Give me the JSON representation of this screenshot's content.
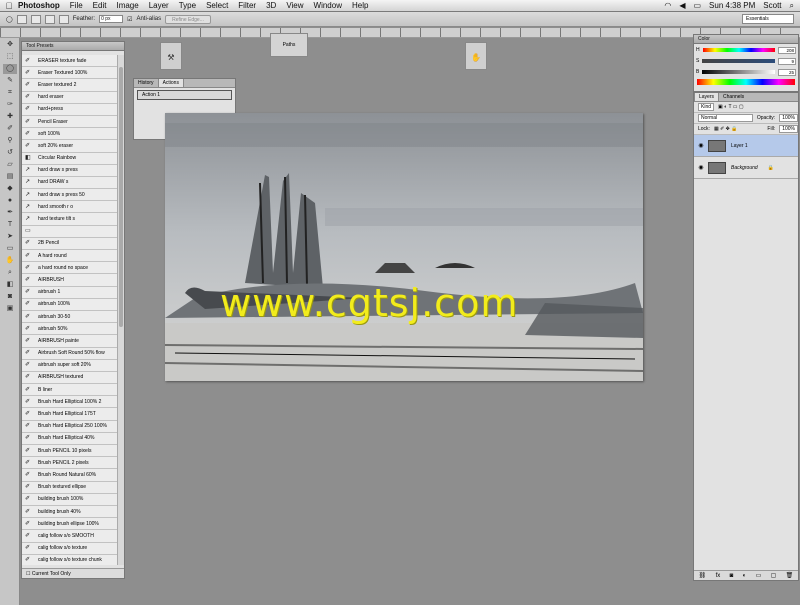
{
  "menubar": {
    "app": "Photoshop",
    "items": [
      "File",
      "Edit",
      "Image",
      "Layer",
      "Type",
      "Select",
      "Filter",
      "3D",
      "View",
      "Window",
      "Help"
    ],
    "time": "Sun 4:38 PM",
    "user": "Scott"
  },
  "options": {
    "feather_label": "Feather:",
    "feather_value": "0 px",
    "antialias_label": "Anti-alias",
    "refine_label": "Refine Edge...",
    "workspace": "Essentials"
  },
  "presets": {
    "title": "Tool Presets",
    "footer": "Current Tool Only",
    "items": [
      "ERASER texture fade",
      "Eraser Textured 100%",
      "Eraser textured 2",
      "hard eraser",
      "hard+press",
      "Pencil Eraser",
      "soft 100%",
      "soft 20% eraser",
      "Circular Rainbow",
      "hard draw s press",
      "hard DRAW s",
      "hard draw s press 50",
      "hard smooth r o",
      "hard texture tilt s",
      "",
      "2B Pencil",
      "A hard round",
      "a hard round no space",
      "AIRBRUSH",
      "airbrush 1",
      "airbrush 100%",
      "airbrush 30-50",
      "airbrush 50%",
      "AIRBRUSH painte",
      "Airbrush Soft Round 50% flow",
      "airbrush super soft 20%",
      "AIRBRUSH textured",
      "B liner",
      "Brush Hard Elliptical 100% 2",
      "Brush Hard Elliptical 175T",
      "Brush Hard Elliptical 250 100%",
      "Brush Hard Elliptical 40%",
      "Brush PENCIL 10 pixels",
      "Brush PENCIL 2 pixels",
      "Brush Round Natural 60%",
      "Brush textured ellipse",
      "building brush 100%",
      "building brush 40%",
      "building brush ellipse 100%",
      "calig follow s/o SMOOTH",
      "calig follow s/o texture",
      "calig follow s/o texture chunk"
    ]
  },
  "history": {
    "tab1": "History",
    "tab2": "Actions",
    "action": "Action 1"
  },
  "paths": {
    "label": "Paths"
  },
  "watermark": "www.cgtsj.com",
  "color": {
    "tab": "Color",
    "h": "208",
    "s": "9",
    "b": "25"
  },
  "layers": {
    "tab1": "Layers",
    "tab2": "Channels",
    "kind": "Kind",
    "blend": "Normal",
    "opacity_label": "Opacity:",
    "opacity": "100%",
    "lock_label": "Lock:",
    "fill_label": "Fill:",
    "fill": "100%",
    "items": [
      {
        "name": "Layer 1",
        "selected": true
      },
      {
        "name": "Background",
        "selected": false
      }
    ]
  }
}
